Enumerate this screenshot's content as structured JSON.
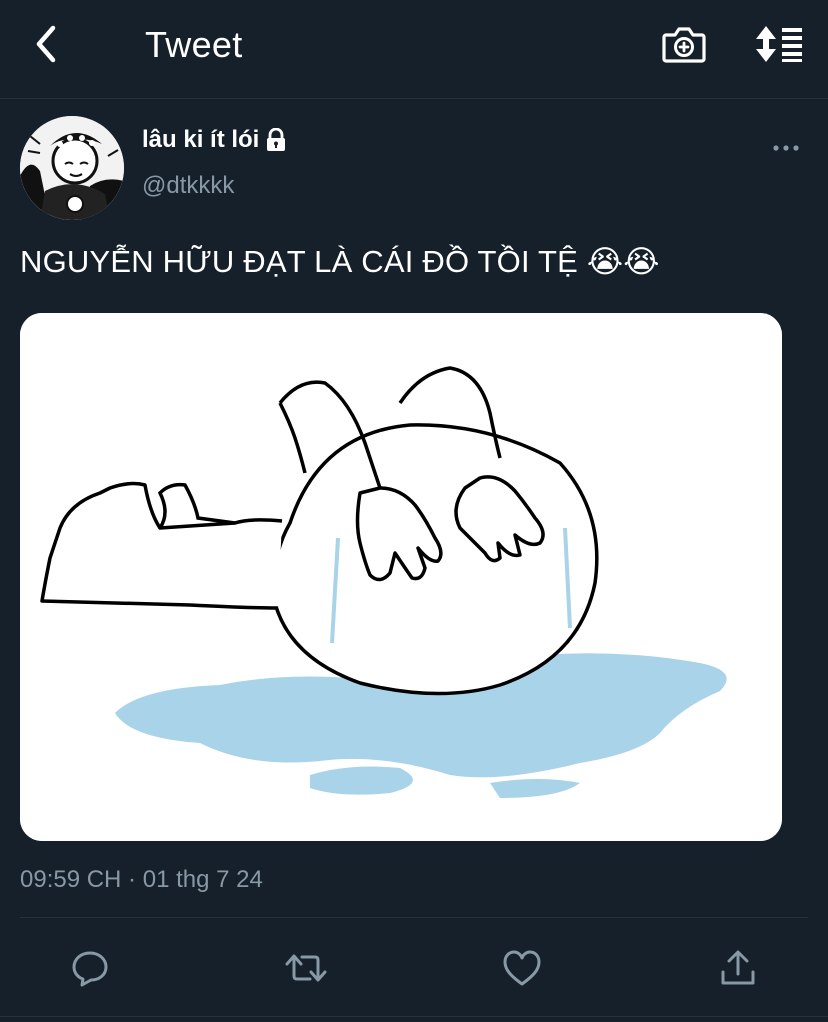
{
  "header": {
    "title": "Tweet",
    "back_icon": "chevron-left-icon",
    "camera_icon": "camera-plus-icon",
    "sort_icon": "sort-icon"
  },
  "tweet": {
    "author": {
      "display_name": "lâu ki ít lói",
      "handle": "@dtkkkk",
      "protected_icon": "lock-icon"
    },
    "text": "NGUYỄN HỮU ĐẠT LÀ CÁI ĐỒ TỒI TỆ 😭😭",
    "media": {
      "type": "image",
      "description_icon": "crying-cartoon-illustration"
    },
    "timestamp": "09:59 CH · 01 thg 7 24"
  },
  "actions": [
    {
      "name": "reply",
      "icon": "reply-icon"
    },
    {
      "name": "retweet",
      "icon": "retweet-icon"
    },
    {
      "name": "like",
      "icon": "heart-icon"
    },
    {
      "name": "share",
      "icon": "share-icon"
    }
  ],
  "colors": {
    "background": "#15202b",
    "secondary_text": "#8899a6",
    "divider": "#253341",
    "puddle": "#a9d3e8"
  }
}
